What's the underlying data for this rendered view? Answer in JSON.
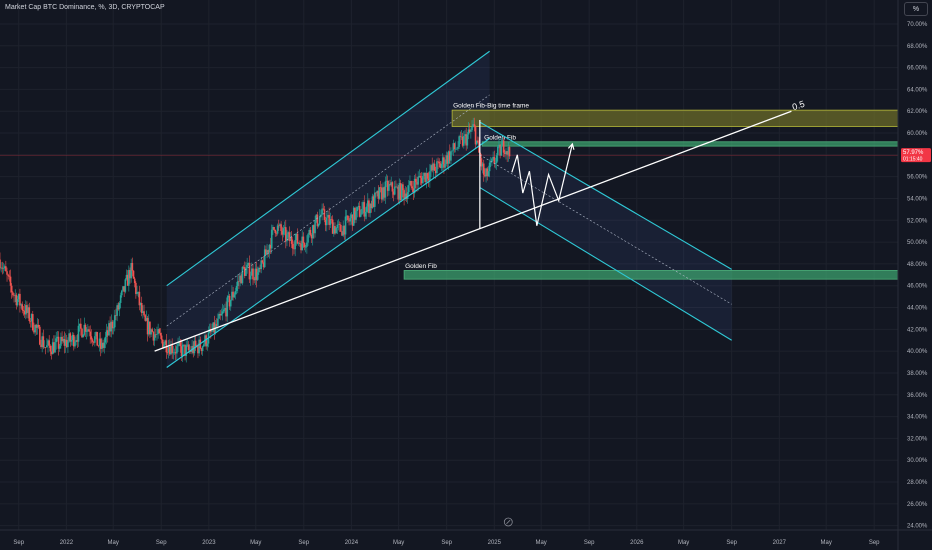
{
  "header": {
    "symbol_title": "Market Cap BTC Dominance, %, 3D, CRYPTOCAP",
    "scale_button": "%"
  },
  "chart_data": {
    "type": "candlestick",
    "title": "Market Cap BTC Dominance, %, 3D, CRYPTOCAP",
    "y_unit": "%",
    "ylim": [
      23.6,
      72.2
    ],
    "y_ticks": [
      24,
      26,
      28,
      30,
      32,
      34,
      36,
      38,
      40,
      42,
      44,
      46,
      48,
      50,
      52,
      54,
      56,
      58,
      60,
      62,
      64,
      66,
      68,
      70
    ],
    "y_tick_labels": [
      "24.00%",
      "26.00%",
      "28.00%",
      "30.00%",
      "32.00%",
      "34.00%",
      "36.00%",
      "38.00%",
      "40.00%",
      "42.00%",
      "44.00%",
      "46.00%",
      "48.00%",
      "50.00%",
      "52.00%",
      "54.00%",
      "56.00%",
      "58.00%",
      "60.00%",
      "62.00%",
      "64.00%",
      "66.00%",
      "68.00%",
      "70.00%"
    ],
    "xlim": [
      "2021-07-15",
      "2027-11-01"
    ],
    "x_ticks": [
      {
        "date": "2021-09-01",
        "label": "Sep"
      },
      {
        "date": "2022-01-01",
        "label": "2022"
      },
      {
        "date": "2022-05-01",
        "label": "May"
      },
      {
        "date": "2022-09-01",
        "label": "Sep"
      },
      {
        "date": "2023-01-01",
        "label": "2023"
      },
      {
        "date": "2023-05-01",
        "label": "May"
      },
      {
        "date": "2023-09-01",
        "label": "Sep"
      },
      {
        "date": "2024-01-01",
        "label": "2024"
      },
      {
        "date": "2024-05-01",
        "label": "May"
      },
      {
        "date": "2024-09-01",
        "label": "Sep"
      },
      {
        "date": "2025-01-01",
        "label": "2025"
      },
      {
        "date": "2025-05-01",
        "label": "May"
      },
      {
        "date": "2025-09-01",
        "label": "Sep"
      },
      {
        "date": "2026-01-01",
        "label": "2026"
      },
      {
        "date": "2026-05-01",
        "label": "May"
      },
      {
        "date": "2026-09-01",
        "label": "Sep"
      },
      {
        "date": "2027-01-01",
        "label": "2027"
      },
      {
        "date": "2027-05-01",
        "label": "May"
      },
      {
        "date": "2027-09-01",
        "label": "Sep"
      }
    ],
    "grid": true,
    "current_price": {
      "value": 57.97,
      "label": "57.97%",
      "countdown": "01:15:40"
    },
    "series_anchors": [
      {
        "date": "2021-07-15",
        "value": 48.4
      },
      {
        "date": "2021-08-15",
        "value": 45.5
      },
      {
        "date": "2021-10-01",
        "value": 43.0
      },
      {
        "date": "2021-11-10",
        "value": 40.3
      },
      {
        "date": "2021-12-10",
        "value": 40.6
      },
      {
        "date": "2022-01-15",
        "value": 41.0
      },
      {
        "date": "2022-02-20",
        "value": 42.4
      },
      {
        "date": "2022-04-01",
        "value": 40.2
      },
      {
        "date": "2022-05-10",
        "value": 43.5
      },
      {
        "date": "2022-06-15",
        "value": 47.5
      },
      {
        "date": "2022-07-20",
        "value": 42.5
      },
      {
        "date": "2022-09-01",
        "value": 41.0
      },
      {
        "date": "2022-10-05",
        "value": 40.2
      },
      {
        "date": "2022-11-10",
        "value": 40.0
      },
      {
        "date": "2022-12-15",
        "value": 40.6
      },
      {
        "date": "2023-01-20",
        "value": 42.2
      },
      {
        "date": "2023-03-01",
        "value": 45.0
      },
      {
        "date": "2023-04-01",
        "value": 47.5
      },
      {
        "date": "2023-05-10",
        "value": 47.0
      },
      {
        "date": "2023-06-20",
        "value": 51.5
      },
      {
        "date": "2023-07-25",
        "value": 50.2
      },
      {
        "date": "2023-09-01",
        "value": 50.0
      },
      {
        "date": "2023-10-15",
        "value": 52.5
      },
      {
        "date": "2023-12-01",
        "value": 51.0
      },
      {
        "date": "2024-01-10",
        "value": 52.5
      },
      {
        "date": "2024-02-20",
        "value": 53.5
      },
      {
        "date": "2024-04-01",
        "value": 55.0
      },
      {
        "date": "2024-05-15",
        "value": 54.5
      },
      {
        "date": "2024-07-01",
        "value": 56.0
      },
      {
        "date": "2024-08-15",
        "value": 57.0
      },
      {
        "date": "2024-09-20",
        "value": 58.5
      },
      {
        "date": "2024-10-20",
        "value": 59.5
      },
      {
        "date": "2024-11-10",
        "value": 60.5
      },
      {
        "date": "2024-11-22",
        "value": 58.2
      },
      {
        "date": "2024-12-08",
        "value": 55.8
      },
      {
        "date": "2024-12-22",
        "value": 56.8
      },
      {
        "date": "2025-01-10",
        "value": 58.0
      },
      {
        "date": "2025-01-26",
        "value": 59.0
      },
      {
        "date": "2025-02-10",
        "value": 57.97
      }
    ],
    "zones": [
      {
        "start": "2024-09-15",
        "end": "2027-11-01",
        "low": 60.6,
        "high": 62.1,
        "label": "Golden Fib-Big time frame"
      },
      {
        "start": "2024-12-01",
        "end": "2027-11-01",
        "low": 58.8,
        "high": 59.2,
        "label": "Golden Fib"
      },
      {
        "start": "2024-05-15",
        "end": "2027-11-01",
        "low": 46.6,
        "high": 47.4,
        "label": "Golden Fib"
      }
    ],
    "fib_level_label": "0.5",
    "trend_line": {
      "from": {
        "date": "2022-08-15",
        "value": 40.0
      },
      "to": {
        "date": "2027-02-01",
        "value": 62.0
      }
    },
    "ascending_channel": {
      "upper": {
        "from": {
          "date": "2022-09-15",
          "value": 46.0
        },
        "to": {
          "date": "2024-12-20",
          "value": 67.5
        }
      },
      "lower": {
        "from": {
          "date": "2022-09-15",
          "value": 38.5
        },
        "to": {
          "date": "2024-12-20",
          "value": 59.5
        }
      },
      "mid": {
        "from": {
          "date": "2022-09-15",
          "value": 42.3
        },
        "to": {
          "date": "2024-12-20",
          "value": 63.5
        }
      }
    },
    "descending_channel": {
      "upper": {
        "from": {
          "date": "2024-11-25",
          "value": 61.0
        },
        "to": {
          "date": "2026-09-01",
          "value": 47.5
        }
      },
      "lower": {
        "from": {
          "date": "2024-11-25",
          "value": 55.0
        },
        "to": {
          "date": "2026-09-01",
          "value": 41.0
        }
      },
      "mid": {
        "from": {
          "date": "2024-11-25",
          "value": 58.0
        },
        "to": {
          "date": "2026-09-01",
          "value": 44.3
        }
      }
    },
    "vertical_marker": {
      "date": "2024-11-25",
      "from": 61.2,
      "to": 51.2
    },
    "projection_path": [
      {
        "date": "2025-02-15",
        "value": 56.4
      },
      {
        "date": "2025-03-01",
        "value": 58.0
      },
      {
        "date": "2025-03-15",
        "value": 54.5
      },
      {
        "date": "2025-04-01",
        "value": 56.5
      },
      {
        "date": "2025-04-20",
        "value": 51.5
      },
      {
        "date": "2025-05-20",
        "value": 56.2
      },
      {
        "date": "2025-06-15",
        "value": 53.8
      },
      {
        "date": "2025-07-20",
        "value": 59.0
      }
    ]
  }
}
